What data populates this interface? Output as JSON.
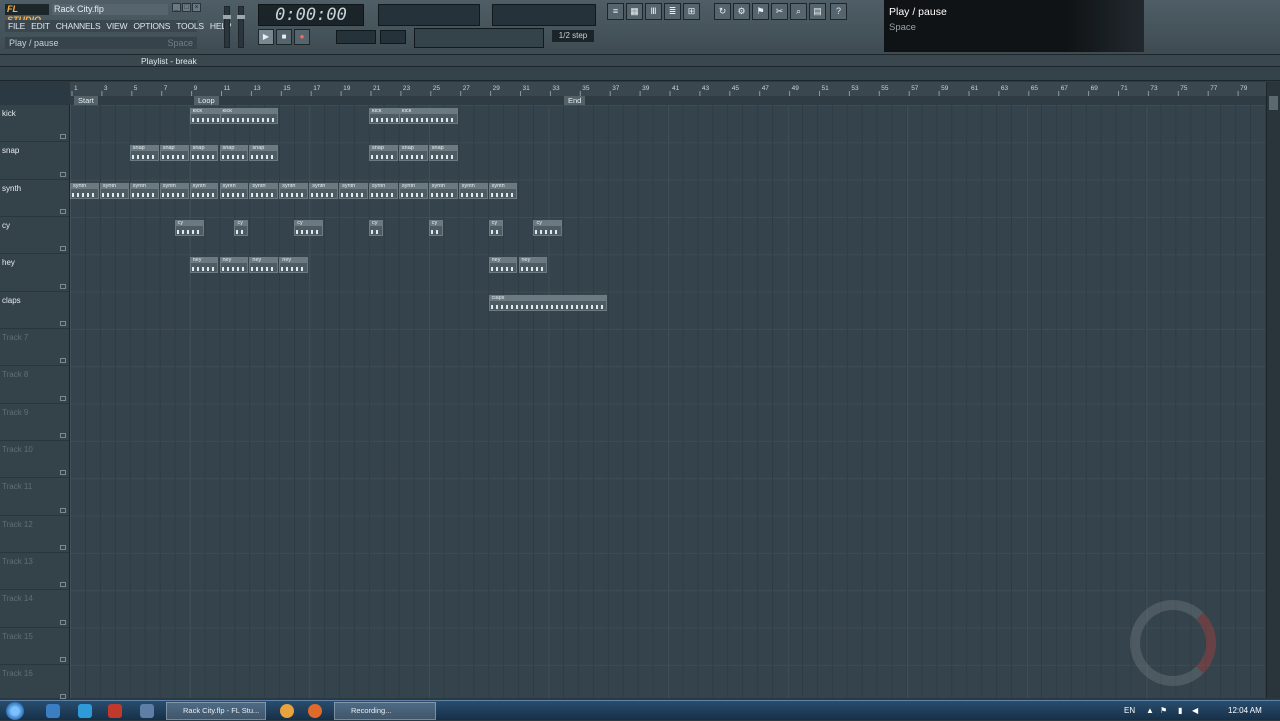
{
  "app": {
    "logo": "FL STUDIO",
    "project_title": "Rack City.flp",
    "window_buttons": [
      "_",
      "□",
      "×"
    ]
  },
  "menu": [
    "FILE",
    "EDIT",
    "CHANNELS",
    "VIEW",
    "OPTIONS",
    "TOOLS",
    "HELP"
  ],
  "hint_bar": {
    "text": "Play / pause",
    "shortcut": "Space"
  },
  "transport": {
    "time": "0:00:00",
    "play_glyph": "▶",
    "stop_glyph": "■",
    "record_glyph": "●",
    "step": "1/2 step"
  },
  "tooltip": {
    "title": "Play / pause",
    "shortcut": "Space"
  },
  "playlist": {
    "title": "Playlist - break",
    "ruler_numbers": [
      "1",
      "3",
      "5",
      "7",
      "9",
      "11",
      "13",
      "15",
      "17",
      "19",
      "21",
      "23",
      "25",
      "27",
      "29",
      "31",
      "33",
      "35",
      "37",
      "39",
      "41",
      "43",
      "45",
      "47",
      "49",
      "51",
      "53",
      "55",
      "57",
      "59",
      "61",
      "63",
      "65",
      "67",
      "69",
      "71",
      "73",
      "75",
      "77",
      "79"
    ],
    "markers": {
      "start": "Start",
      "loop": "Loop",
      "end": "End"
    },
    "tracks": [
      {
        "name": "kick",
        "empty": false
      },
      {
        "name": "snap",
        "empty": false
      },
      {
        "name": "synth",
        "empty": false
      },
      {
        "name": "cy",
        "empty": false
      },
      {
        "name": "hey",
        "empty": false
      },
      {
        "name": "claps",
        "empty": false
      },
      {
        "name": "Track 7",
        "empty": true
      },
      {
        "name": "Track 8",
        "empty": true
      },
      {
        "name": "Track 9",
        "empty": true
      },
      {
        "name": "Track 10",
        "empty": true
      },
      {
        "name": "Track 11",
        "empty": true
      },
      {
        "name": "Track 12",
        "empty": true
      },
      {
        "name": "Track 13",
        "empty": true
      },
      {
        "name": "Track 14",
        "empty": true
      },
      {
        "name": "Track 15",
        "empty": true
      },
      {
        "name": "Track 16",
        "empty": true
      }
    ],
    "clips": [
      {
        "track": 0,
        "start": 9,
        "len": 2,
        "label": "kick"
      },
      {
        "track": 0,
        "start": 11,
        "len": 2,
        "label": "kick"
      },
      {
        "track": 0,
        "start": 21,
        "len": 2,
        "label": "kick"
      },
      {
        "track": 0,
        "start": 23,
        "len": 2,
        "label": "kick"
      },
      {
        "track": 1,
        "start": 5,
        "len": 1,
        "label": "snap"
      },
      {
        "track": 1,
        "start": 7,
        "len": 1,
        "label": "snap"
      },
      {
        "track": 1,
        "start": 9,
        "len": 1,
        "label": "snap"
      },
      {
        "track": 1,
        "start": 11,
        "len": 1,
        "label": "snap"
      },
      {
        "track": 1,
        "start": 13,
        "len": 1,
        "label": "snap"
      },
      {
        "track": 1,
        "start": 21,
        "len": 1,
        "label": "snap"
      },
      {
        "track": 1,
        "start": 23,
        "len": 1,
        "label": "snap"
      },
      {
        "track": 1,
        "start": 25,
        "len": 1,
        "label": "snap"
      },
      {
        "track": 2,
        "start": 1,
        "len": 1,
        "label": "synth"
      },
      {
        "track": 2,
        "start": 3,
        "len": 1,
        "label": "synth"
      },
      {
        "track": 2,
        "start": 5,
        "len": 1,
        "label": "synth"
      },
      {
        "track": 2,
        "start": 7,
        "len": 1,
        "label": "synth"
      },
      {
        "track": 2,
        "start": 9,
        "len": 1,
        "label": "synth"
      },
      {
        "track": 2,
        "start": 11,
        "len": 1,
        "label": "synth"
      },
      {
        "track": 2,
        "start": 13,
        "len": 1,
        "label": "synth"
      },
      {
        "track": 2,
        "start": 15,
        "len": 1,
        "label": "synth"
      },
      {
        "track": 2,
        "start": 17,
        "len": 1,
        "label": "synth"
      },
      {
        "track": 2,
        "start": 19,
        "len": 1,
        "label": "synth"
      },
      {
        "track": 2,
        "start": 21,
        "len": 1,
        "label": "synth"
      },
      {
        "track": 2,
        "start": 23,
        "len": 1,
        "label": "synth"
      },
      {
        "track": 2,
        "start": 25,
        "len": 1,
        "label": "synth"
      },
      {
        "track": 2,
        "start": 27,
        "len": 1,
        "label": "synth"
      },
      {
        "track": 2,
        "start": 29,
        "len": 1,
        "label": "synth"
      },
      {
        "track": 3,
        "start": 8,
        "len": 1,
        "label": "cy"
      },
      {
        "track": 3,
        "start": 12,
        "len": 0.5,
        "label": "cy"
      },
      {
        "track": 3,
        "start": 16,
        "len": 1,
        "label": "cy"
      },
      {
        "track": 3,
        "start": 21,
        "len": 0.5,
        "label": "cy"
      },
      {
        "track": 3,
        "start": 25,
        "len": 0.5,
        "label": "cy"
      },
      {
        "track": 3,
        "start": 29,
        "len": 0.5,
        "label": "cy"
      },
      {
        "track": 3,
        "start": 32,
        "len": 1,
        "label": "cy"
      },
      {
        "track": 4,
        "start": 9,
        "len": 1,
        "label": "hey"
      },
      {
        "track": 4,
        "start": 11,
        "len": 1,
        "label": "hey"
      },
      {
        "track": 4,
        "start": 13,
        "len": 1,
        "label": "hey"
      },
      {
        "track": 4,
        "start": 15,
        "len": 1,
        "label": "hey"
      },
      {
        "track": 4,
        "start": 29,
        "len": 1,
        "label": "hey"
      },
      {
        "track": 4,
        "start": 31,
        "len": 1,
        "label": "hey"
      },
      {
        "track": 5,
        "start": 29,
        "len": 4,
        "label": "claps"
      }
    ]
  },
  "taskbar": {
    "tasks": [
      "Rack City.flp - FL Stu...",
      "Recording..."
    ],
    "language": "EN",
    "clock": "12:04 AM"
  }
}
